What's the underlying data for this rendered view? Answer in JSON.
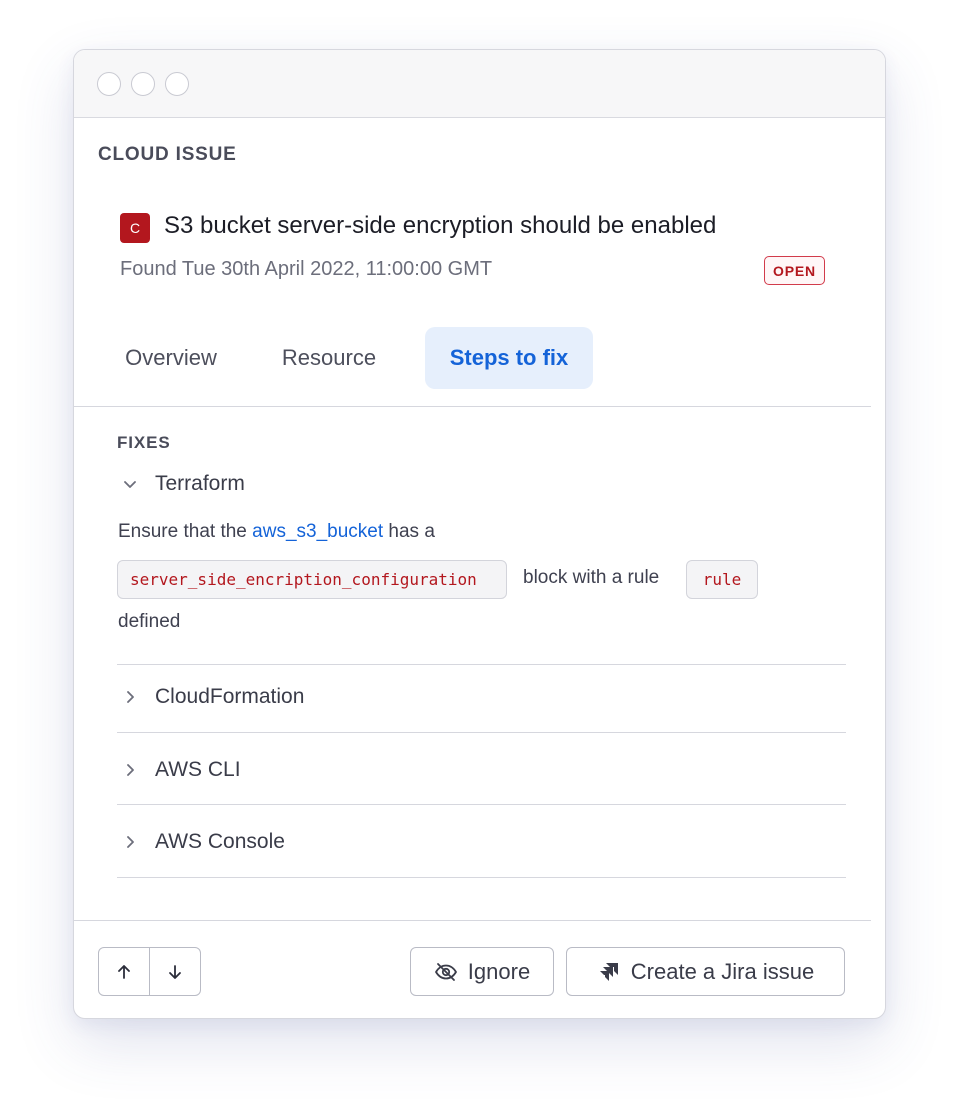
{
  "section_label": "CLOUD ISSUE",
  "issue": {
    "severity_letter": "C",
    "title": "S3 bucket server-side encryption should be enabled",
    "found": "Found Tue 30th April 2022, 11:00:00 GMT",
    "status": "OPEN"
  },
  "tabs": [
    {
      "label": "Overview",
      "active": false
    },
    {
      "label": "Resource",
      "active": false
    },
    {
      "label": "Steps to fix",
      "active": true
    }
  ],
  "fixes": {
    "label": "FIXES",
    "items": [
      {
        "label": "Terraform",
        "expanded": true
      },
      {
        "label": "CloudFormation",
        "expanded": false
      },
      {
        "label": "AWS CLI",
        "expanded": false
      },
      {
        "label": "AWS Console",
        "expanded": false
      }
    ],
    "terraform_text": {
      "prefix": "Ensure that the",
      "link": "aws_s3_bucket",
      "suffix": "has a",
      "code1": "server_side_encription_configuration",
      "middle": "block with a rule",
      "code2": "rule",
      "end": "defined"
    }
  },
  "footer": {
    "ignore_label": "Ignore",
    "jira_label": "Create a Jira issue"
  },
  "colors": {
    "accent": "#1463d8",
    "critical": "#b3171e",
    "active_tab_bg": "#e6effc"
  }
}
